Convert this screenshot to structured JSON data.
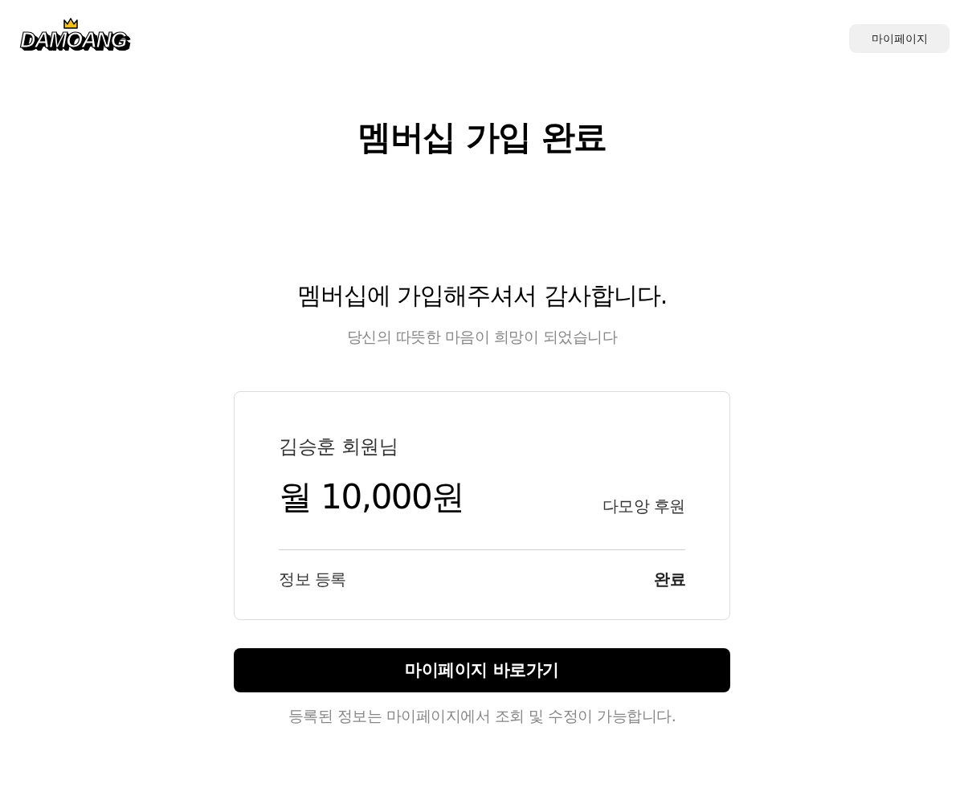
{
  "header": {
    "logo": {
      "text": "DAMOANG"
    },
    "mypage_button": "마이페이지"
  },
  "title": "멤버십 가입 완료",
  "thanks": {
    "heading": "멤버십에 가입해주셔서 감사합니다.",
    "subtext": "당신의 따뜻한 마음이 희망이 되었습니다"
  },
  "summary_card": {
    "member_name": "김승훈 회원님",
    "amount": "월 10,000원",
    "product": "다모앙 후원",
    "rows": [
      {
        "label": "정보 등록",
        "value": "완료"
      }
    ]
  },
  "primary_button": "마이페이지 바로가기",
  "note": "등록된 정보는 마이페이지에서 조회 및 수정이 가능합니다."
}
